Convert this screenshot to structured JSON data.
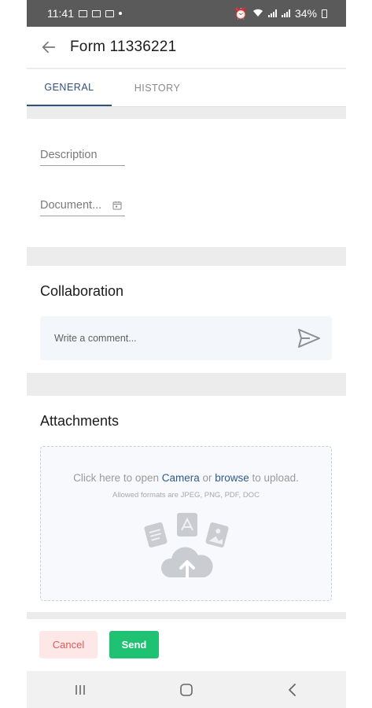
{
  "status_bar": {
    "time": "11:41",
    "battery": "34%"
  },
  "app_bar": {
    "title": "Form 11336221"
  },
  "tabs": [
    {
      "label": "GENERAL",
      "active": true
    },
    {
      "label": "HISTORY",
      "active": false
    }
  ],
  "general": {
    "description_label": "Description",
    "document_date_label": "Document..."
  },
  "collaboration": {
    "title": "Collaboration",
    "comment_placeholder": "Write a comment..."
  },
  "attachments": {
    "title": "Attachments",
    "prompt_prefix": "Click here to open ",
    "camera_link": "Camera",
    "prompt_or": " or ",
    "browse_link": "browse",
    "prompt_suffix": " to upload.",
    "allowed_formats": "Allowed formats are JPEG, PNG, PDF, DOC"
  },
  "footer": {
    "cancel_label": "Cancel",
    "send_label": "Send"
  },
  "colors": {
    "accent": "#2f4f7f",
    "send_button": "#1fc173",
    "cancel_bg": "#fde7e7",
    "cancel_text": "#e05a5a",
    "link": "#2e5b8d"
  },
  "icons": [
    "back-arrow-icon",
    "calendar-icon",
    "send-icon",
    "document-icon",
    "pdf-icon",
    "image-icon",
    "cloud-upload-icon",
    "recents-icon",
    "home-icon",
    "nav-back-icon"
  ]
}
